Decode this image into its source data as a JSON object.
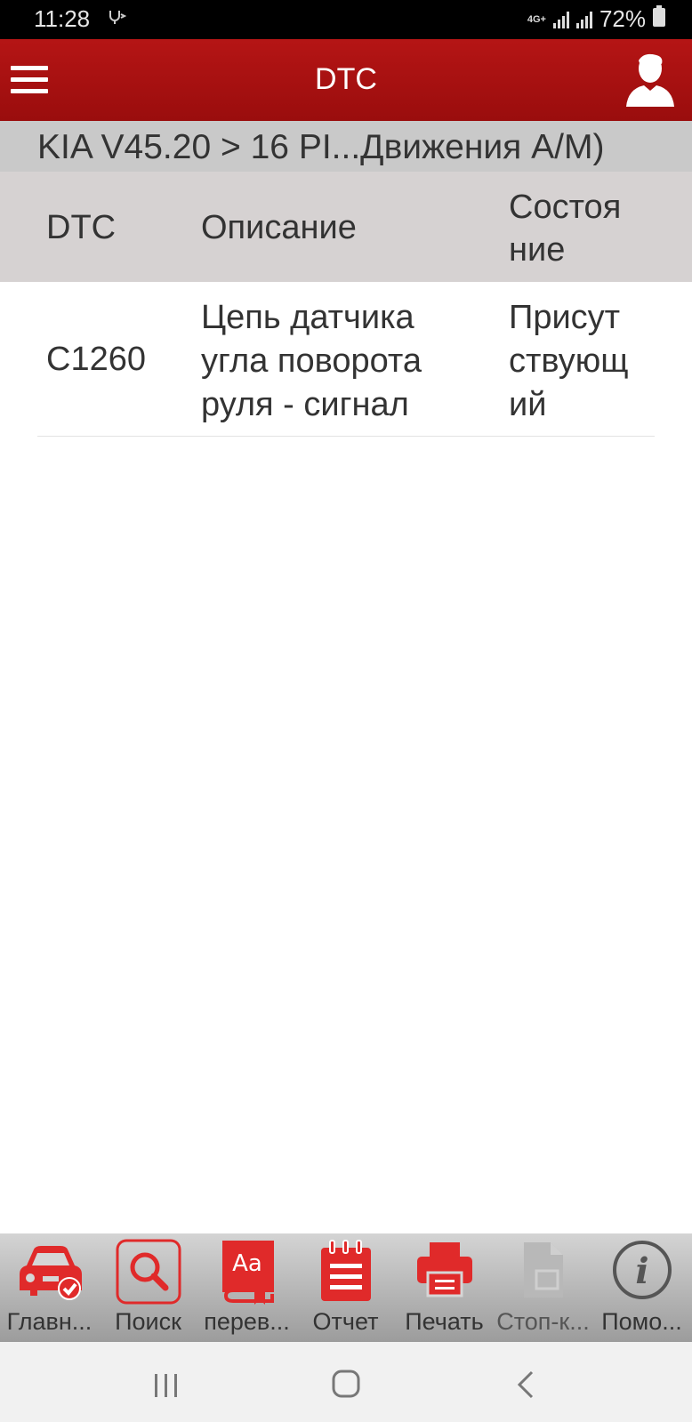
{
  "status_bar": {
    "time": "11:28",
    "network": "4G+",
    "battery": "72%"
  },
  "app_bar": {
    "title": "DTC"
  },
  "breadcrumb": "KIA V45.20 > 16 PI...Движения A/M)",
  "table": {
    "headers": {
      "code": "DTC",
      "description": "Описание",
      "status": "Состоя ние"
    },
    "rows": [
      {
        "code": "C1260",
        "description": "Цепь датчика угла поворота руля - сигнал",
        "status": "Присут ствующ ий"
      }
    ]
  },
  "toolbar": {
    "items": [
      {
        "label": "Главн...",
        "icon": "car-check-icon"
      },
      {
        "label": "Поиск",
        "icon": "search-icon"
      },
      {
        "label": "перев...",
        "icon": "translate-book-icon"
      },
      {
        "label": "Отчет",
        "icon": "report-notepad-icon"
      },
      {
        "label": "Печать",
        "icon": "printer-icon"
      },
      {
        "label": "Стоп-к...",
        "icon": "document-icon"
      },
      {
        "label": "Помо...",
        "icon": "info-icon"
      }
    ]
  },
  "colors": {
    "accent": "#ad1212",
    "icon_red": "#e02a2a"
  }
}
